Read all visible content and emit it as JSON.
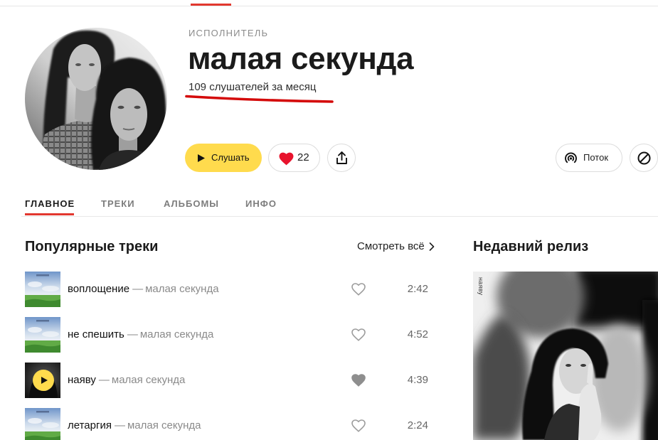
{
  "colors": {
    "accent": "#ffdb4d",
    "like_red": "#e8132d",
    "tab_active": "#e2382f",
    "annotation": "#d40a0a",
    "text_main": "#1b1b1b",
    "text_muted": "#8c8c8c"
  },
  "icons": {
    "play": "play-icon",
    "like": "heart-icon",
    "share": "share-icon",
    "flow": "radio-wave-icon",
    "block": "block-icon",
    "see_all": "chevron-right-icon"
  },
  "artist": {
    "label": "ИСПОЛНИТЕЛЬ",
    "name": "малая секунда",
    "listeners": "109 слушателей за месяц"
  },
  "actions": {
    "play_label": "Слушать",
    "likes_count": "22",
    "liked": true,
    "flow_label": "Поток"
  },
  "tabs": [
    {
      "label": "ГЛАВНОЕ",
      "active": true
    },
    {
      "label": "ТРЕКИ",
      "active": false
    },
    {
      "label": "АЛЬБОМЫ",
      "active": false
    },
    {
      "label": "ИНФО",
      "active": false
    }
  ],
  "popular": {
    "title": "Популярные треки",
    "see_all": "Смотреть всё",
    "separator": "—",
    "tracks": [
      {
        "title": "воплощение",
        "artist": "малая секунда",
        "duration": "2:42",
        "hovered": false
      },
      {
        "title": "не спешить",
        "artist": "малая секунда",
        "duration": "4:52",
        "hovered": false
      },
      {
        "title": "наяву",
        "artist": "малая секунда",
        "duration": "4:39",
        "hovered": true
      },
      {
        "title": "летаргия",
        "artist": "малая секунда",
        "duration": "2:24",
        "hovered": false
      }
    ]
  },
  "recent": {
    "title": "Недавний релиз",
    "cover_text": "наяву"
  }
}
